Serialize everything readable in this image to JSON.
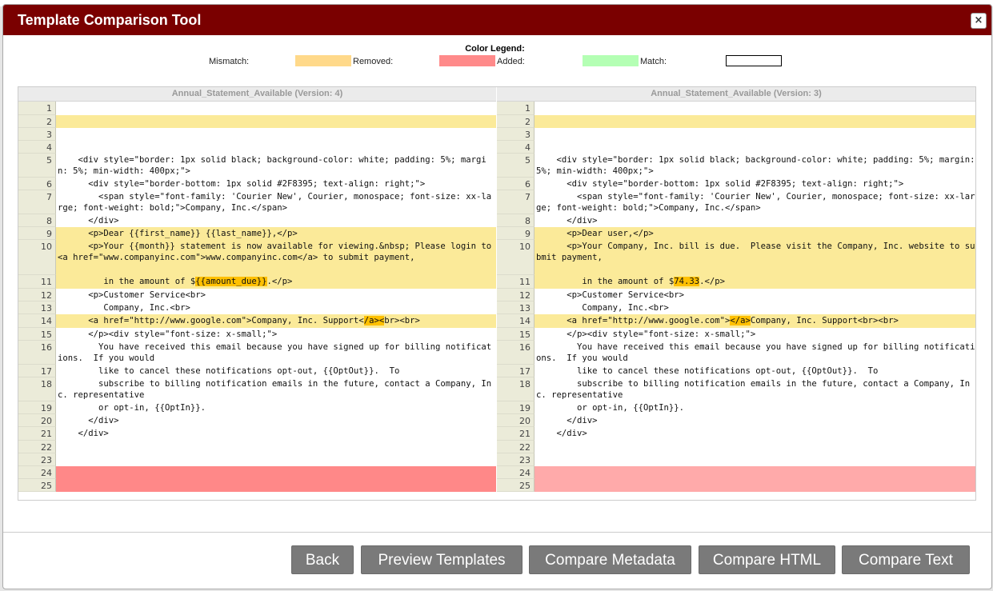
{
  "window": {
    "title": "Template Comparison Tool",
    "close_glyph": "×"
  },
  "legend": {
    "title": "Color Legend:",
    "items": [
      {
        "label": "Mismatch:",
        "color": "#ffd98a"
      },
      {
        "label": "Removed:",
        "color": "#ff8a8a"
      },
      {
        "label": "Added:",
        "color": "#b4ffb4"
      },
      {
        "label": "Match:",
        "color": "#ffffff"
      }
    ]
  },
  "left": {
    "header": "Annual_Statement_Available (Version: 4)",
    "lines": [
      {
        "n": "1",
        "state": "match",
        "h": 17,
        "parts": [
          ""
        ]
      },
      {
        "n": "2",
        "state": "mismatch",
        "h": 16,
        "parts": [
          ""
        ]
      },
      {
        "n": "3",
        "state": "match",
        "h": 16,
        "parts": [
          ""
        ]
      },
      {
        "n": "4",
        "state": "match",
        "h": 16,
        "parts": [
          ""
        ]
      },
      {
        "n": "5",
        "state": "match",
        "h": 30,
        "parts": [
          "    <div style=\"border: 1px solid black; background-color: white; padding: 5%; margin: 5%; min-width: 400px;\">"
        ]
      },
      {
        "n": "6",
        "state": "match",
        "h": 16,
        "parts": [
          "      <div style=\"border-bottom: 1px solid #2F8395; text-align: right;\">"
        ]
      },
      {
        "n": "7",
        "state": "match",
        "h": 30,
        "parts": [
          "        <span style=\"font-family: 'Courier New', Courier, monospace; font-size: xx-large; font-weight: bold;\">Company, Inc.</span>"
        ]
      },
      {
        "n": "8",
        "state": "match",
        "h": 16,
        "parts": [
          "      </div>"
        ]
      },
      {
        "n": "9",
        "state": "mismatch",
        "h": 16,
        "parts": [
          "      <p>Dear {{first_name}} {{last_name}},</p>"
        ]
      },
      {
        "n": "10",
        "state": "mismatch",
        "h": 44,
        "parts": [
          "      <p>Your {{month}} statement is now available for viewing.&nbsp; Please login to <a href=\"www.companyinc.com\">www.companyinc.com</a> to submit payment,"
        ]
      },
      {
        "n": "11",
        "state": "mismatch",
        "h": 17,
        "parts": [
          "         in the amount of $",
          {
            "hl": "{{amount_due}}"
          },
          ".</p>"
        ]
      },
      {
        "n": "12",
        "state": "match",
        "h": 16,
        "parts": [
          "      <p>Customer Service<br>"
        ]
      },
      {
        "n": "13",
        "state": "match",
        "h": 16,
        "parts": [
          "         Company, Inc.<br>"
        ]
      },
      {
        "n": "14",
        "state": "mismatch",
        "h": 17,
        "parts": [
          "      <a href=\"http://www.google.com\">Company, Inc. Support<",
          {
            "hl": "/a>"
          },
          {
            "hl": "<"
          },
          "br><br>"
        ]
      },
      {
        "n": "15",
        "state": "match",
        "h": 16,
        "parts": [
          "      </p><div style=\"font-size: x-small;\">"
        ]
      },
      {
        "n": "16",
        "state": "match",
        "h": 30,
        "parts": [
          "        You have received this email because you have signed up for billing notifications.  If you would"
        ]
      },
      {
        "n": "17",
        "state": "match",
        "h": 16,
        "parts": [
          "        like to cancel these notifications opt-out, {{OptOut}}.  To"
        ]
      },
      {
        "n": "18",
        "state": "match",
        "h": 30,
        "parts": [
          "        subscribe to billing notification emails in the future, contact a Company, Inc. representative"
        ]
      },
      {
        "n": "19",
        "state": "match",
        "h": 16,
        "parts": [
          "        or opt-in, {{OptIn}}."
        ]
      },
      {
        "n": "20",
        "state": "match",
        "h": 16,
        "parts": [
          "      </div>"
        ]
      },
      {
        "n": "21",
        "state": "match",
        "h": 17,
        "parts": [
          "    </div>"
        ]
      },
      {
        "n": "22",
        "state": "match",
        "h": 16,
        "parts": [
          ""
        ]
      },
      {
        "n": "23",
        "state": "match",
        "h": 16,
        "parts": [
          ""
        ]
      },
      {
        "n": "24",
        "state": "removed",
        "h": 16,
        "parts": [
          ""
        ]
      },
      {
        "n": "25",
        "state": "removed",
        "h": 16,
        "parts": [
          ""
        ]
      }
    ]
  },
  "right": {
    "header": "Annual_Statement_Available (Version: 3)",
    "lines": [
      {
        "n": "1",
        "state": "match",
        "h": 17,
        "parts": [
          ""
        ]
      },
      {
        "n": "2",
        "state": "mismatch",
        "h": 16,
        "parts": [
          ""
        ]
      },
      {
        "n": "3",
        "state": "match",
        "h": 16,
        "parts": [
          ""
        ]
      },
      {
        "n": "4",
        "state": "match",
        "h": 16,
        "parts": [
          ""
        ]
      },
      {
        "n": "5",
        "state": "match",
        "h": 30,
        "parts": [
          "    <div style=\"border: 1px solid black; background-color: white; padding: 5%; margin: 5%; min-width: 400px;\">"
        ]
      },
      {
        "n": "6",
        "state": "match",
        "h": 16,
        "parts": [
          "      <div style=\"border-bottom: 1px solid #2F8395; text-align: right;\">"
        ]
      },
      {
        "n": "7",
        "state": "match",
        "h": 30,
        "parts": [
          "        <span style=\"font-family: 'Courier New', Courier, monospace; font-size: xx-large; font-weight: bold;\">Company, Inc.</span>"
        ]
      },
      {
        "n": "8",
        "state": "match",
        "h": 16,
        "parts": [
          "      </div>"
        ]
      },
      {
        "n": "9",
        "state": "mismatch",
        "h": 16,
        "parts": [
          "      <p>Dear user,</p>"
        ]
      },
      {
        "n": "10",
        "state": "mismatch",
        "h": 44,
        "parts": [
          "      <p>Your Company, Inc. bill is due.  Please visit the Company, Inc. website to submit payment,"
        ]
      },
      {
        "n": "11",
        "state": "mismatch",
        "h": 17,
        "parts": [
          "         in the amount of $",
          {
            "hl": "74.33"
          },
          ".</p>"
        ]
      },
      {
        "n": "12",
        "state": "match",
        "h": 16,
        "parts": [
          "      <p>Customer Service<br>"
        ]
      },
      {
        "n": "13",
        "state": "match",
        "h": 16,
        "parts": [
          "         Company, Inc.<br>"
        ]
      },
      {
        "n": "14",
        "state": "mismatch",
        "h": 17,
        "parts": [
          "      <a href=\"http://www.google.com\">",
          {
            "hl": "</a>"
          },
          "Company, Inc. Support<br><br>"
        ]
      },
      {
        "n": "15",
        "state": "match",
        "h": 16,
        "parts": [
          "      </p><div style=\"font-size: x-small;\">"
        ]
      },
      {
        "n": "16",
        "state": "match",
        "h": 30,
        "parts": [
          "        You have received this email because you have signed up for billing notifications.  If you would"
        ]
      },
      {
        "n": "17",
        "state": "match",
        "h": 16,
        "parts": [
          "        like to cancel these notifications opt-out, {{OptOut}}.  To"
        ]
      },
      {
        "n": "18",
        "state": "match",
        "h": 30,
        "parts": [
          "        subscribe to billing notification emails in the future, contact a Company, Inc. representative"
        ]
      },
      {
        "n": "19",
        "state": "match",
        "h": 16,
        "parts": [
          "        or opt-in, {{OptIn}}."
        ]
      },
      {
        "n": "20",
        "state": "match",
        "h": 16,
        "parts": [
          "      </div>"
        ]
      },
      {
        "n": "21",
        "state": "match",
        "h": 17,
        "parts": [
          "    </div>"
        ]
      },
      {
        "n": "22",
        "state": "match",
        "h": 16,
        "parts": [
          ""
        ]
      },
      {
        "n": "23",
        "state": "match",
        "h": 16,
        "parts": [
          ""
        ]
      },
      {
        "n": "24",
        "state": "added",
        "h": 16,
        "parts": [
          ""
        ]
      },
      {
        "n": "25",
        "state": "added",
        "h": 16,
        "parts": [
          ""
        ]
      }
    ]
  },
  "buttons": {
    "back": "Back",
    "preview": "Preview Templates",
    "metadata": "Compare Metadata",
    "html": "Compare HTML",
    "text": "Compare Text"
  }
}
